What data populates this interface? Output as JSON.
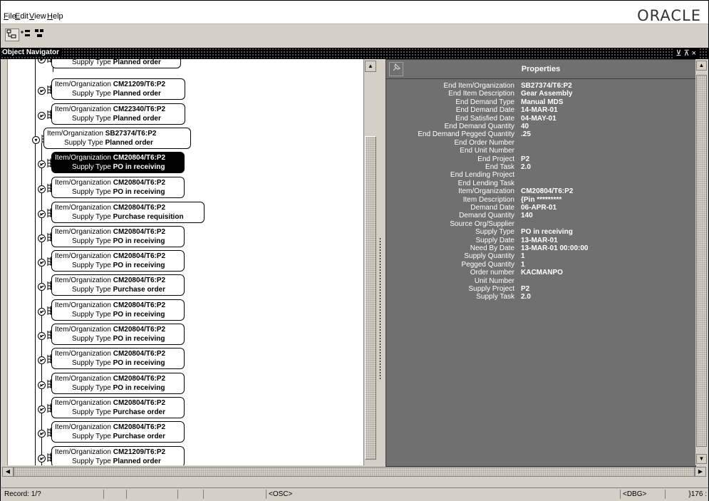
{
  "menu": {
    "items": [
      {
        "mnemonic": "F",
        "rest": "ile"
      },
      {
        "mnemonic": "E",
        "rest": "dit"
      },
      {
        "mnemonic": "V",
        "rest": "iew"
      },
      {
        "mnemonic": "H",
        "rest": "elp"
      }
    ],
    "logo": "ORACLE"
  },
  "window": {
    "title": "Object Navigator",
    "controls": "⊻ ⊼ ×"
  },
  "tree": {
    "label_item": "Item/Organization",
    "label_supply": "Supply Type",
    "nodes": [
      {
        "item": "",
        "supply": "Planned order"
      },
      {
        "item": "CM21209/T6:P2",
        "supply": "Planned order"
      },
      {
        "item": "CM22340/T6:P2",
        "supply": "Planned order"
      },
      {
        "item": "SB27374/T6:P2",
        "supply": "Planned order"
      },
      {
        "item": "CM20804/T6:P2",
        "supply": "PO in receiving"
      },
      {
        "item": "CM20804/T6:P2",
        "supply": "PO in receiving"
      },
      {
        "item": "CM20804/T6:P2",
        "supply": "Purchase requisition"
      },
      {
        "item": "CM20804/T6:P2",
        "supply": "PO in receiving"
      },
      {
        "item": "CM20804/T6:P2",
        "supply": "PO in receiving"
      },
      {
        "item": "CM20804/T6:P2",
        "supply": "Purchase order"
      },
      {
        "item": "CM20804/T6:P2",
        "supply": "PO in receiving"
      },
      {
        "item": "CM20804/T6:P2",
        "supply": "PO in receiving"
      },
      {
        "item": "CM20804/T6:P2",
        "supply": "PO in receiving"
      },
      {
        "item": "CM20804/T6:P2",
        "supply": "PO in receiving"
      },
      {
        "item": "CM20804/T6:P2",
        "supply": "Purchase order"
      },
      {
        "item": "CM20804/T6:P2",
        "supply": "Purchase order"
      },
      {
        "item": "CM21209/T6:P2",
        "supply": "Planned order"
      }
    ]
  },
  "properties": {
    "title": "Properties",
    "rows": [
      {
        "label": "End Item/Organization",
        "value": "SB27374/T6:P2"
      },
      {
        "label": "End Item Description",
        "value": "Gear Assembly"
      },
      {
        "label": "End Demand Type",
        "value": "Manual MDS"
      },
      {
        "label": "End Demand Date",
        "value": "14-MAR-01"
      },
      {
        "label": "End Satisfied Date",
        "value": "04-MAY-01"
      },
      {
        "label": "End Demand Quantity",
        "value": "40"
      },
      {
        "label": "End Demand Pegged Quantity",
        "value": ".25"
      },
      {
        "label": "End Order Number",
        "value": ""
      },
      {
        "label": "End Unit Number",
        "value": ""
      },
      {
        "label": "End Project",
        "value": "P2"
      },
      {
        "label": "End Task",
        "value": "2.0"
      },
      {
        "label": "End Lending Project",
        "value": ""
      },
      {
        "label": "End Lending Task",
        "value": ""
      },
      {
        "label": "Item/Organization",
        "value": "CM20804/T6:P2"
      },
      {
        "label": "Item Description",
        "value": "{Pin *********"
      },
      {
        "label": "Demand Date",
        "value": "06-APR-01"
      },
      {
        "label": "Demand Quantity",
        "value": "140"
      },
      {
        "label": "Source Org/Supplier",
        "value": ""
      },
      {
        "label": "Supply Type",
        "value": "PO in receiving"
      },
      {
        "label": "Supply Date",
        "value": "13-MAR-01"
      },
      {
        "label": "Need By Date",
        "value": "13-MAR-01 00:00:00"
      },
      {
        "label": "Supply Quantity",
        "value": "1"
      },
      {
        "label": "Pegged Quantity",
        "value": "1"
      },
      {
        "label": "Order number",
        "value": "KACMANPO"
      },
      {
        "label": "Unit Number",
        "value": ""
      },
      {
        "label": "Supply Project",
        "value": "P2"
      },
      {
        "label": "Supply Task",
        "value": "2.0"
      }
    ]
  },
  "status": {
    "record": "Record: 1/?",
    "osc": "<OSC>",
    "dbg": "<DBG>",
    "trail": "}176 :"
  },
  "icons": {
    "pin": "pin-icon",
    "expand": "expand-node-icon",
    "node": "tree-node-icon"
  }
}
